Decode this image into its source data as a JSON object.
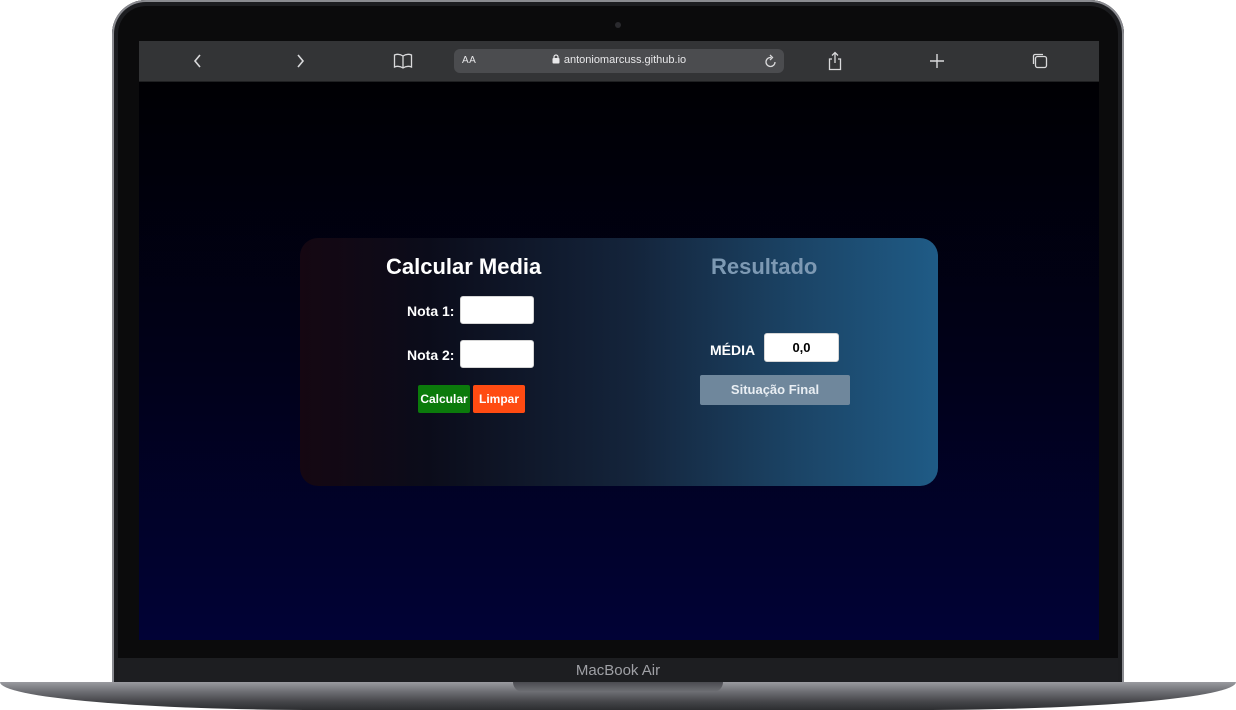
{
  "device": {
    "brand_label": "MacBook Air"
  },
  "browser": {
    "reader_label": "AA",
    "url": "antoniomarcuss.github.io",
    "icons": {
      "back": "chevron-left-icon",
      "forward": "chevron-right-icon",
      "bookmarks": "book-icon",
      "lock": "lock-icon",
      "reload": "reload-icon",
      "share": "share-icon",
      "new_tab": "plus-icon",
      "tabs": "tabs-icon"
    }
  },
  "calculator": {
    "title": "Calcular Media",
    "nota1_label": "Nota 1:",
    "nota1_value": "",
    "nota2_label": "Nota 2:",
    "nota2_value": "",
    "calcular_label": "Calcular",
    "limpar_label": "Limpar",
    "colors": {
      "calcular": "#0b7a0b",
      "limpar": "#ff4b12"
    }
  },
  "resultado": {
    "title": "Resultado",
    "media_label": "MÉDIA",
    "media_value": "0,0",
    "situacao_label": "Situação Final"
  }
}
